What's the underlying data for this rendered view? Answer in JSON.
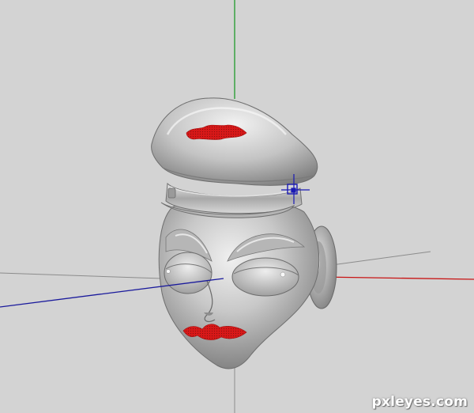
{
  "viewport": {
    "background": "#d3d3d3",
    "axes": {
      "x_color": "#c81414",
      "y_color": "#1e9a2a",
      "z_color": "#1a1a9c",
      "grid_color": "#8c8c8c"
    },
    "model": {
      "surface_color": "#a8a8a8",
      "highlight_color": "#eeeeee",
      "selection_color": "#d81818"
    },
    "gizmo_color": "#1a1ab4"
  },
  "watermark": {
    "text": "pxleyes.com"
  }
}
